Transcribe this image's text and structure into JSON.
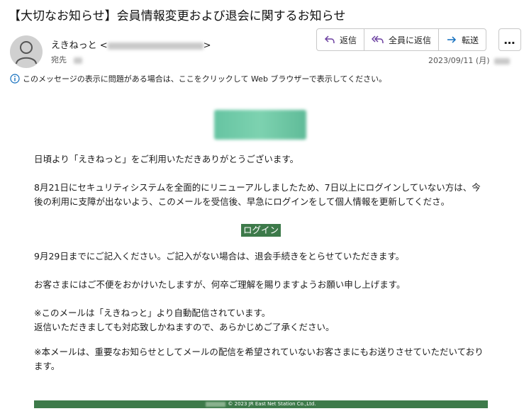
{
  "email": {
    "subject": "【大切なお知らせ】会員情報変更および退会に関するお知らせ",
    "sender_name": "えきねっと",
    "sender_open": "<",
    "sender_close": ">",
    "to_label": "宛先",
    "date": "2023/09/11 (月)",
    "info_banner": "このメッセージの表示に問題がある場合は、ここをクリックして Web ブラウザーで表示してください。"
  },
  "actions": {
    "reply": "返信",
    "reply_all": "全員に返信",
    "forward": "転送",
    "more": "…"
  },
  "body": {
    "greeting": "日頃より「えきねっと」をご利用いただきありがとうございます。",
    "paragraph1": "8月21日にセキュリティシステムを全面的にリニューアルしましたため、7日以上にログインしていない方は、今後の利用に支障が出ないよう、このメールを受信後、早急にログインをして個人情報を更新してくださ。",
    "login_button": "ログイン",
    "paragraph2": "9月29日までにご記入ください。ご記入がない場合は、退会手続きをとらせていただきます。",
    "paragraph3": "お客さまにはご不便をおかけいたしますが、何卒ご理解を賜りますようお願い申し上げます。",
    "note1_line1": "※このメールは「えきねっと」より自動配信されています。",
    "note1_line2": "返信いただきましても対応致しかねますので、あらかじめご了承ください。",
    "note2": "※本メールは、重要なお知らせとしてメールの配信を希望されていないお客さまにもお送りさせていただいております。"
  },
  "footer": {
    "copyright": "© 2023 JR East Net Station Co.,Ltd."
  },
  "colors": {
    "accent_green": "#3d7a4a",
    "action_icon_purple": "#6b3fa0",
    "info_icon_blue": "#0f6cbd"
  }
}
